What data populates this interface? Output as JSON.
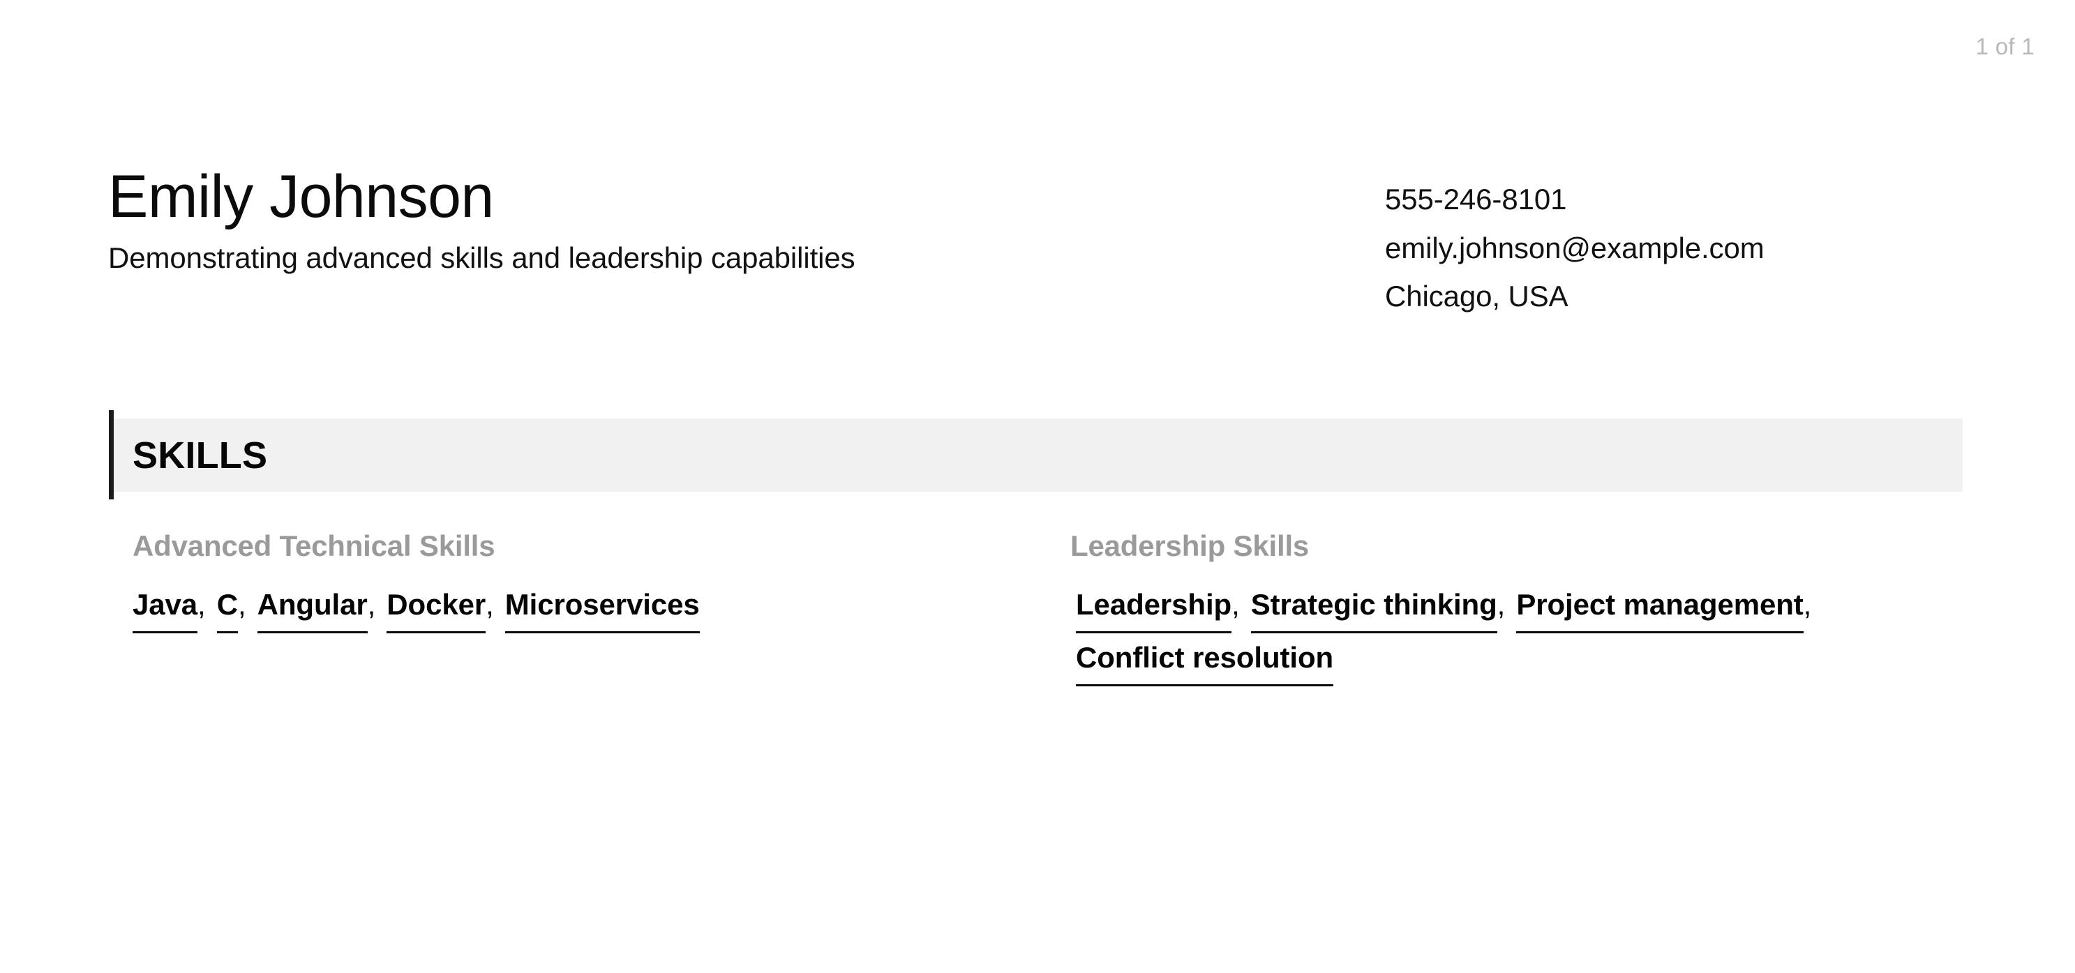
{
  "viewer": {
    "page_indicator": "1 of 1"
  },
  "resume": {
    "header": {
      "name": "Emily Johnson",
      "tagline": "Demonstrating advanced skills and leadership capabilities",
      "contact": {
        "phone": "555-246-8101",
        "email": "emily.johnson@example.com",
        "location": "Chicago, USA"
      }
    },
    "sections": [
      {
        "title": "SKILLS",
        "groups": [
          {
            "title": "Advanced Technical Skills",
            "items": [
              "Java",
              "C",
              "Angular",
              "Docker",
              "Microservices"
            ]
          },
          {
            "title": "Leadership Skills",
            "items": [
              "Leadership",
              "Strategic thinking",
              "Project management",
              "Conflict resolution"
            ]
          }
        ]
      }
    ]
  },
  "colors": {
    "section_band": "#f1f1f1",
    "section_accent": "#1c1c1c",
    "group_title": "#9a9a9a",
    "page_indicator": "#b8b8b8",
    "text": "#0a0a0a"
  }
}
